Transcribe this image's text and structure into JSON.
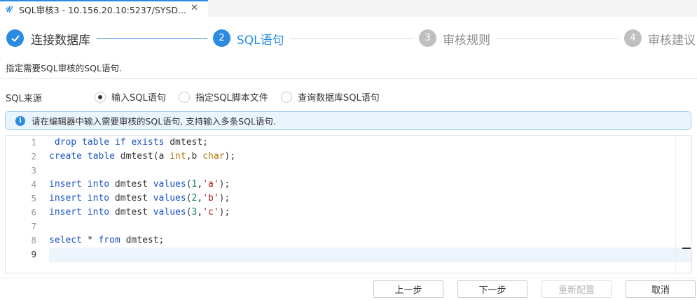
{
  "tab": {
    "title": "SQL审核3 - 10.156.20.10:5237/SYSD...",
    "close_glyph": "✕"
  },
  "steps": [
    {
      "label": "连接数据库",
      "status": "done"
    },
    {
      "number": "2",
      "label": "SQL语句",
      "status": "active"
    },
    {
      "number": "3",
      "label": "审核规则",
      "status": "pending"
    },
    {
      "number": "4",
      "label": "审核建议",
      "status": "pending"
    }
  ],
  "description": "指定需要SQL审核的SQL语句.",
  "sql_source": {
    "label": "SQL来源",
    "options": [
      "输入SQL语句",
      "指定SQL脚本文件",
      "查询数据库SQL语句"
    ],
    "selected_index": 0
  },
  "info": {
    "icon": "i",
    "text": "请在编辑器中输入需要审核的SQL语句, 支持输入多条SQL语句."
  },
  "editor": {
    "line_numbers": [
      "1",
      "2",
      "3",
      "4",
      "5",
      "6",
      "7",
      "8",
      "9"
    ],
    "active_line": 9,
    "lines": [
      " drop table if exists dmtest;",
      "create table dmtest(a int,b char);",
      "",
      "insert into dmtest values(1,'a');",
      "insert into dmtest values(2,'b');",
      "insert into dmtest values(3,'c');",
      "",
      "select * from dmtest;",
      ""
    ]
  },
  "buttons": {
    "prev": "上一步",
    "next": "下一步",
    "reconfigure": "重新配置",
    "cancel": "取消"
  },
  "colors": {
    "accent": "#2a8be0",
    "pending": "#bfbfbf",
    "keyword": "#1a55c6"
  }
}
